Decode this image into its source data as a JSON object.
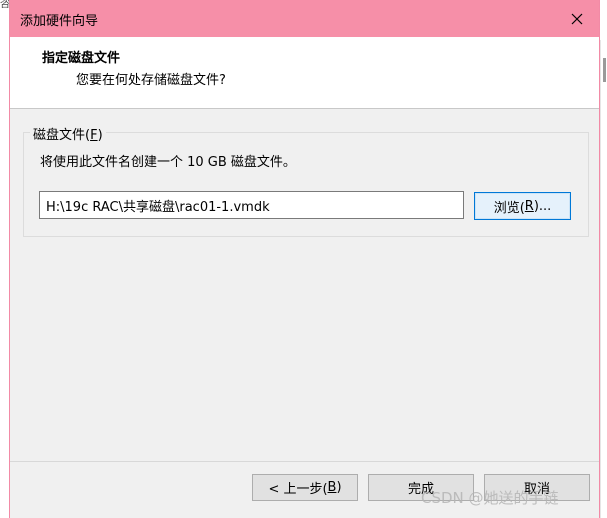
{
  "background": {
    "corner_glyph": "咨"
  },
  "dialog": {
    "title": "添加硬件向导",
    "close_icon": "close-icon"
  },
  "header": {
    "title": "指定磁盘文件",
    "subtitle": "您要在何处存储磁盘文件?"
  },
  "disk_group": {
    "legend_prefix": "磁盘文件(",
    "legend_key": "F",
    "legend_suffix": ")",
    "info": "将使用此文件名创建一个 10 GB 磁盘文件。",
    "path_value": "H:\\19c RAC\\共享磁盘\\rac01-1.vmdk",
    "browse_prefix": "浏览(",
    "browse_key": "R",
    "browse_suffix": ")..."
  },
  "footer": {
    "prev_prefix": "< 上一步(",
    "prev_key": "B",
    "prev_suffix": ")",
    "finish": "完成",
    "cancel": "取消"
  },
  "watermark": "CSDN @她送的手链",
  "colors": {
    "titlebar": "#f68fa8",
    "dialog_border": "#f28aa6",
    "focus_border": "#0078d7"
  }
}
